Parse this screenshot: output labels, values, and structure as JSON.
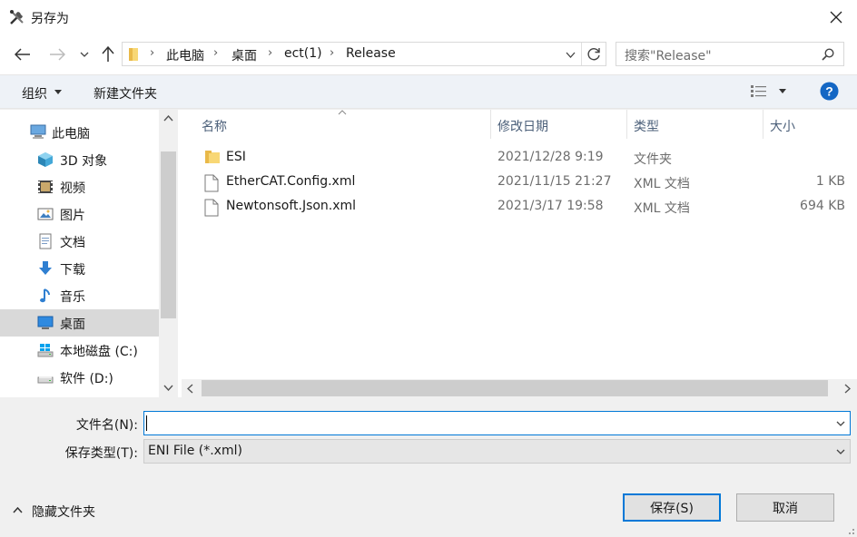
{
  "window": {
    "title": "另存为"
  },
  "nav": {
    "breadcrumb": [
      "此电脑",
      "桌面",
      "ect(1)",
      "Release"
    ],
    "search_placeholder": "搜索\"Release\""
  },
  "toolbar": {
    "organize": "组织",
    "new_folder": "新建文件夹"
  },
  "sidebar": {
    "items": [
      {
        "label": "此电脑",
        "icon": "computer-icon"
      },
      {
        "label": "3D 对象",
        "icon": "3d-objects-icon"
      },
      {
        "label": "视频",
        "icon": "video-icon"
      },
      {
        "label": "图片",
        "icon": "pictures-icon"
      },
      {
        "label": "文档",
        "icon": "documents-icon"
      },
      {
        "label": "下载",
        "icon": "download-icon"
      },
      {
        "label": "音乐",
        "icon": "music-icon"
      },
      {
        "label": "桌面",
        "icon": "desktop-icon"
      },
      {
        "label": "本地磁盘 (C:)",
        "icon": "windows-drive-icon"
      },
      {
        "label": "软件 (D:)",
        "icon": "drive-icon"
      }
    ],
    "selected_index": 7
  },
  "columns": {
    "name": "名称",
    "modified": "修改日期",
    "type": "类型",
    "size": "大小"
  },
  "files": [
    {
      "name": "ESI",
      "modified": "2021/12/28 9:19",
      "type": "文件夹",
      "size": "",
      "icon": "folder-icon"
    },
    {
      "name": "EtherCAT.Config.xml",
      "modified": "2021/11/15 21:27",
      "type": "XML 文档",
      "size": "1 KB",
      "icon": "file-icon"
    },
    {
      "name": "Newtonsoft.Json.xml",
      "modified": "2021/3/17 19:58",
      "type": "XML 文档",
      "size": "694 KB",
      "icon": "file-icon"
    }
  ],
  "form": {
    "filename_label": "文件名(N):",
    "filename_value": "",
    "filetype_label": "保存类型(T):",
    "filetype_value": "ENI File (*.xml)"
  },
  "footer": {
    "hide_folders": "隐藏文件夹",
    "save": "保存(S)",
    "cancel": "取消"
  },
  "colors": {
    "accent": "#0078d7",
    "help": "#1467c4",
    "folder": "#f8d775"
  }
}
